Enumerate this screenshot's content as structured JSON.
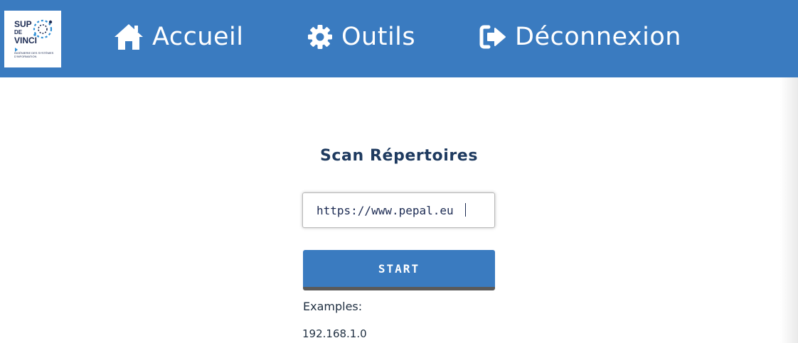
{
  "logo": {
    "line1": "SUP",
    "line2": "DE",
    "line3": "VINCI",
    "tagline": "Ingénierie des systèmes d'information"
  },
  "nav": {
    "items": [
      {
        "label": "Accueil",
        "icon": "home-icon"
      },
      {
        "label": "Outils",
        "icon": "gear-icon"
      },
      {
        "label": "Déconnexion",
        "icon": "sign-out-icon"
      }
    ]
  },
  "colors": {
    "navbar": "#3a7bc0",
    "button": "#3a7bc0",
    "title_text": "#1e3a5f"
  },
  "main": {
    "title": "Scan Répertoires",
    "url_input": {
      "value": "https://www.pepal.eu",
      "placeholder": ""
    },
    "start_label": "START",
    "examples_label": "Examples:",
    "examples": [
      "192.168.1.0"
    ]
  }
}
